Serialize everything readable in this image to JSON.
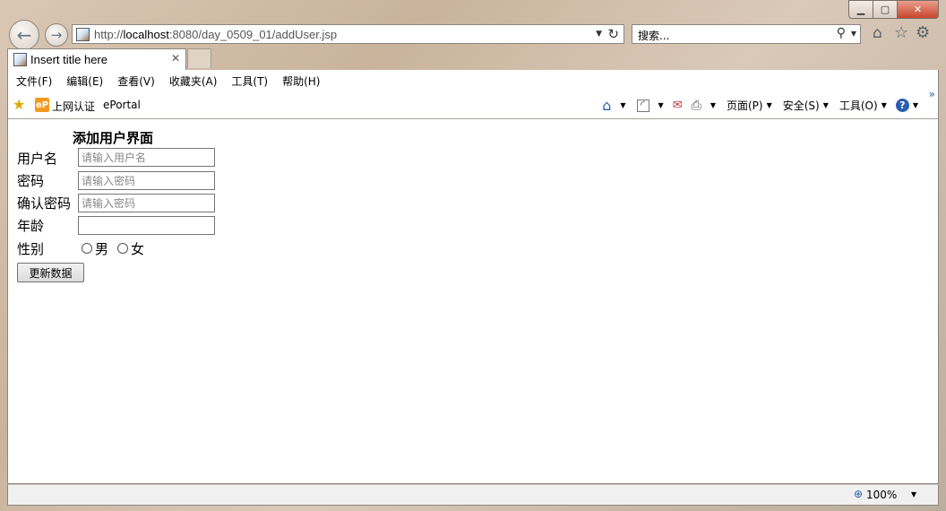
{
  "window": {
    "min_glyph": "▁",
    "max_glyph": "▢",
    "close_glyph": "✕"
  },
  "nav": {
    "back_glyph": "←",
    "forward_glyph": "→"
  },
  "address": {
    "scheme": "http://",
    "host": "localhost",
    "path": ":8080/day_0509_01/addUser.jsp"
  },
  "search": {
    "placeholder": "搜索..."
  },
  "tab": {
    "title": "Insert title here",
    "close_glyph": "✕"
  },
  "menu": [
    "文件(F)",
    "编辑(E)",
    "查看(V)",
    "收藏夹(A)",
    "工具(T)",
    "帮助(H)"
  ],
  "favorites": {
    "item1": "上网认证",
    "item2": "ePortal",
    "ep_badge": "eP"
  },
  "commandbar": {
    "page": "页面(P)",
    "safety": "安全(S)",
    "tools": "工具(O)",
    "more": "»"
  },
  "form": {
    "title": "添加用户界面",
    "username_label": "用户名",
    "username_placeholder": "请输入用户名",
    "password_label": "密码",
    "password_placeholder": "请输入密码",
    "confirm_label": "确认密码",
    "confirm_placeholder": "请输入密码",
    "age_label": "年龄",
    "age_value": "",
    "gender_label": "性别",
    "gender_male": "男",
    "gender_female": "女",
    "submit_label": "更新数据"
  },
  "statusbar": {
    "zoom": "100%"
  },
  "colors": {
    "accent_blue": "#2a5db0",
    "ep_orange": "#f39a1e",
    "close_red": "#c8452c"
  }
}
